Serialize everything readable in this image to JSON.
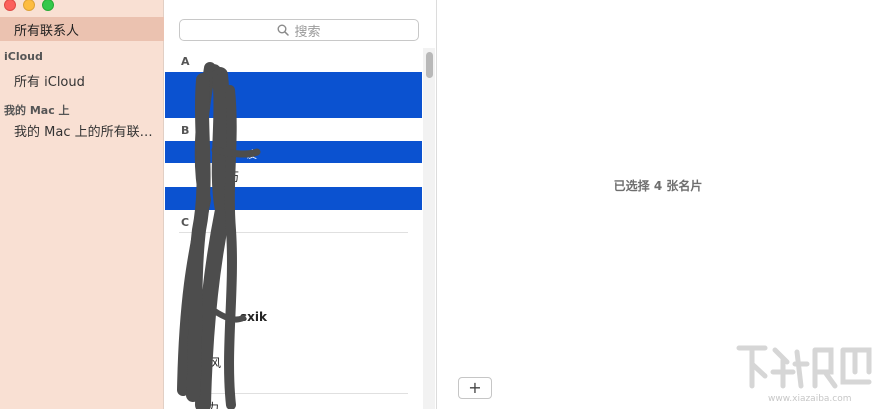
{
  "sidebar": {
    "selected_label": "所有联系人",
    "sections": [
      {
        "header": "iCloud",
        "item": "所有 iCloud"
      },
      {
        "header": "我的 Mac 上",
        "item": "我的 Mac 上的所有联…"
      }
    ]
  },
  "list": {
    "search_placeholder": "搜索",
    "section_letters": [
      "A",
      "B",
      "C"
    ],
    "visible_fragments": [
      {
        "text": "皮"
      },
      {
        "text": "历"
      },
      {
        "text": "-sxik"
      },
      {
        "text": "风"
      },
      {
        "text": "力"
      }
    ]
  },
  "detail": {
    "selection_summary": "已选择 4 张名片",
    "add_label": "+"
  },
  "watermark": {
    "url": "www.xiazaiba.com"
  },
  "colors": {
    "sidebar_bg": "#f9e0d3",
    "sidebar_selected": "#ebc2b0",
    "selection_blue": "#0b52d0"
  },
  "icons": [
    "search-icon",
    "close-button",
    "minimize-button",
    "zoom-button",
    "add-icon"
  ]
}
